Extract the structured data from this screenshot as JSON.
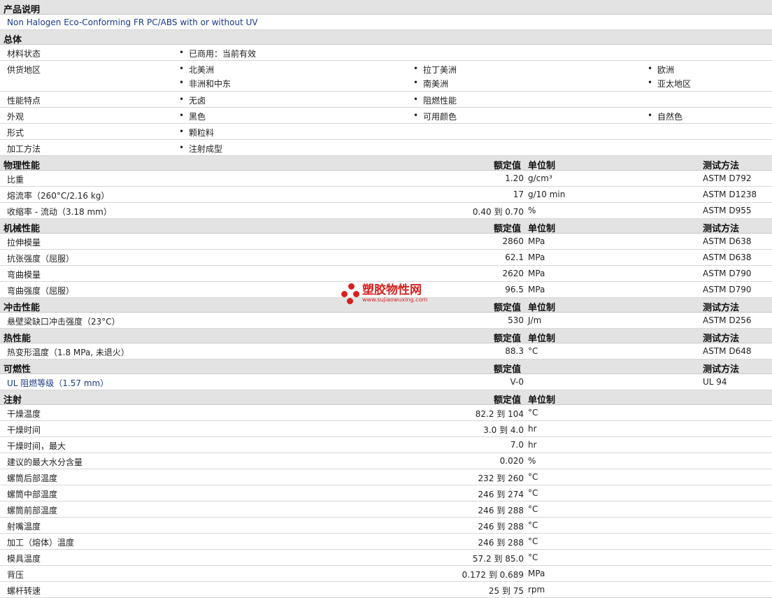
{
  "desc": {
    "title": "产品说明",
    "text": "Non Halogen Eco-Conforming FR PC/ABS with or without UV"
  },
  "general": {
    "title": "总体",
    "rows": [
      {
        "label": "材料状态",
        "items": [
          "已商用：当前有效"
        ]
      },
      {
        "label": "供货地区",
        "items": [
          "北美洲",
          "拉丁美洲",
          "欧洲",
          "非洲和中东",
          "南美洲",
          "亚太地区"
        ]
      },
      {
        "label": "性能特点",
        "items": [
          "无卤",
          "阻燃性能"
        ]
      },
      {
        "label": "外观",
        "items": [
          "黑色",
          "可用颜色",
          "自然色"
        ]
      },
      {
        "label": "形式",
        "items": [
          "颗粒料"
        ]
      },
      {
        "label": "加工方法",
        "items": [
          "注射成型"
        ]
      }
    ]
  },
  "headers": {
    "value": "额定值",
    "unit": "单位制",
    "method": "测试方法"
  },
  "physical": {
    "title": "物理性能",
    "rows": [
      {
        "label": "比重",
        "value": "1.20",
        "unit": "g/cm³",
        "method": "ASTM D792"
      },
      {
        "label": "熔流率（260°C/2.16 kg）",
        "value": "17",
        "unit": "g/10 min",
        "method": "ASTM D1238"
      },
      {
        "label": "收缩率 - 流动（3.18 mm）",
        "value": "0.40 到  0.70",
        "unit": "%",
        "method": "ASTM D955"
      }
    ]
  },
  "mechanical": {
    "title": "机械性能",
    "rows": [
      {
        "label": "拉伸模量",
        "value": "2860",
        "unit": "MPa",
        "method": "ASTM D638"
      },
      {
        "label": "抗张强度（屈服）",
        "value": "62.1",
        "unit": "MPa",
        "method": "ASTM D638"
      },
      {
        "label": "弯曲模量",
        "value": "2620",
        "unit": "MPa",
        "method": "ASTM D790"
      },
      {
        "label": "弯曲强度（屈服）",
        "value": "96.5",
        "unit": "MPa",
        "method": "ASTM D790"
      }
    ]
  },
  "impact": {
    "title": "冲击性能",
    "rows": [
      {
        "label": "悬壁梁缺口冲击强度（23°C）",
        "value": "530",
        "unit": "J/m",
        "method": "ASTM D256"
      }
    ]
  },
  "thermal": {
    "title": "热性能",
    "rows": [
      {
        "label": "热变形温度（1.8 MPa, 未退火）",
        "value": "88.3",
        "unit": "°C",
        "method": "ASTM D648"
      }
    ]
  },
  "flammability": {
    "title": "可燃性",
    "rows": [
      {
        "label": "UL 阻燃等级（1.57 mm）",
        "value": "V-0",
        "unit": "",
        "method": "UL 94"
      }
    ]
  },
  "injection": {
    "title": "注射",
    "rows": [
      {
        "label": "干燥温度",
        "value": "82.2 到  104",
        "unit": "°C"
      },
      {
        "label": "干燥时间",
        "value": "3.0 到  4.0",
        "unit": "hr"
      },
      {
        "label": "干燥时间，最大",
        "value": "7.0",
        "unit": "hr"
      },
      {
        "label": "建议的最大水分含量",
        "value": "0.020",
        "unit": "%"
      },
      {
        "label": "螺筒后部温度",
        "value": "232 到  260",
        "unit": "°C"
      },
      {
        "label": "螺筒中部温度",
        "value": "246 到  274",
        "unit": "°C"
      },
      {
        "label": "螺筒前部温度",
        "value": "246 到  288",
        "unit": "°C"
      },
      {
        "label": "射嘴温度",
        "value": "246 到  288",
        "unit": "°C"
      },
      {
        "label": "加工（熔体）温度",
        "value": "246 到  288",
        "unit": "°C"
      },
      {
        "label": "模具温度",
        "value": "57.2 到  85.0",
        "unit": "°C"
      },
      {
        "label": "背压",
        "value": "0.172 到  0.689",
        "unit": "MPa"
      },
      {
        "label": "螺杆转速",
        "value": "25 到  75",
        "unit": "rpm"
      }
    ]
  },
  "watermark": {
    "main": "塑胶物性网",
    "sub": "www.sujiaowuxing.com",
    "color": "#d62020"
  }
}
